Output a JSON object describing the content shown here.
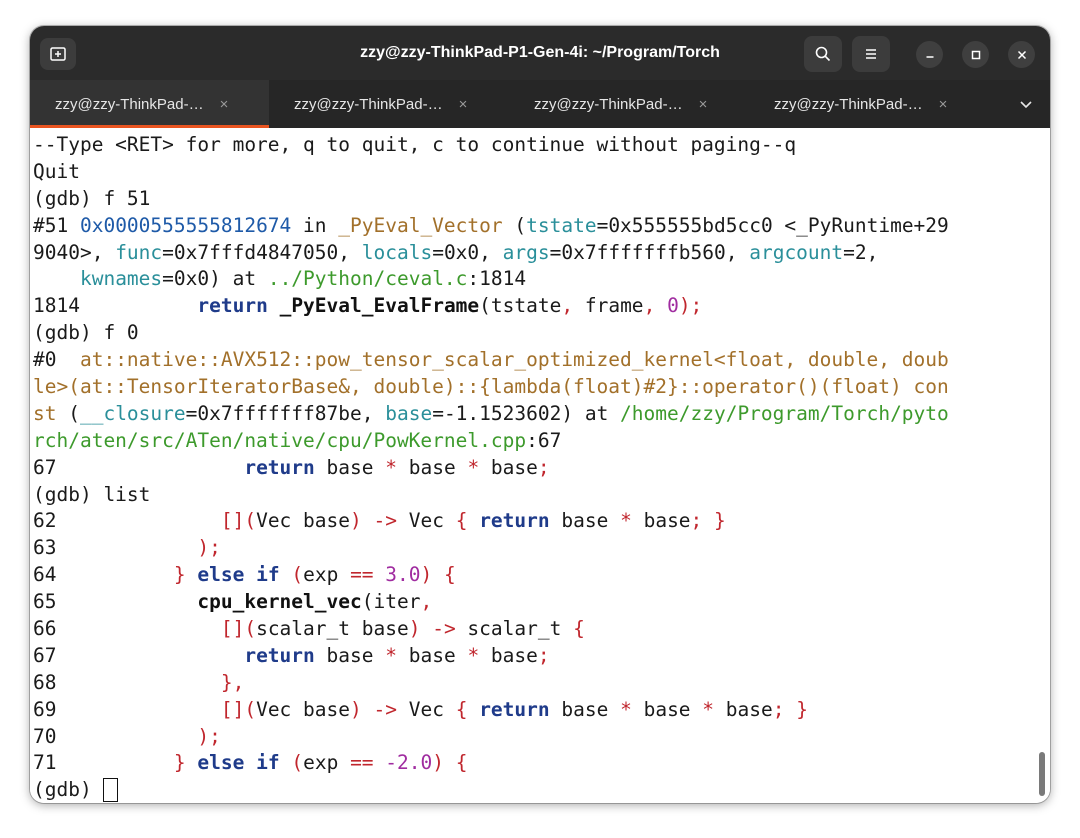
{
  "window": {
    "title": "zzy@zzy-ThinkPad-P1-Gen-4i: ~/Program/Torch"
  },
  "header_icons": {
    "new_tab": "new-tab-icon",
    "search": "search-icon",
    "menu": "hamburger-menu-icon",
    "minimize": "minimize-icon",
    "maximize": "maximize-icon",
    "close": "close-icon"
  },
  "tabs": [
    {
      "label": "zzy@zzy-ThinkPad-…",
      "active": true
    },
    {
      "label": "zzy@zzy-ThinkPad-…",
      "active": false
    },
    {
      "label": "zzy@zzy-ThinkPad-…",
      "active": false
    },
    {
      "label": "zzy@zzy-ThinkPad-…",
      "active": false
    }
  ],
  "tab_close_glyph": "×",
  "colors": {
    "keyword": "#1f3b8a",
    "operator": "#c0262d",
    "number": "#a02ca0",
    "address": "#1e5aa8",
    "param": "#2a8f9a",
    "function_name": "#a2702a",
    "path": "#3d9a2c",
    "tab_active_accent": "#e95420"
  },
  "terminal": {
    "lines": [
      [
        {
          "t": "--Type <RET> for more, q to quit, c to continue without paging--q"
        }
      ],
      [
        {
          "t": "Quit"
        }
      ],
      [
        {
          "t": "(gdb) f 51"
        }
      ],
      [
        {
          "t": "#51 "
        },
        {
          "t": "0x0000555555812674",
          "c": "addr"
        },
        {
          "t": " in "
        },
        {
          "t": "_PyEval_Vector",
          "c": "brown"
        },
        {
          "t": " ("
        },
        {
          "t": "tstate",
          "c": "teal"
        },
        {
          "t": "=0x555555bd5cc0 <_PyRuntime+29"
        }
      ],
      [
        {
          "t": "9040>, "
        },
        {
          "t": "func",
          "c": "teal"
        },
        {
          "t": "=0x7fffd4847050, "
        },
        {
          "t": "locals",
          "c": "teal"
        },
        {
          "t": "=0x0, "
        },
        {
          "t": "args",
          "c": "teal"
        },
        {
          "t": "=0x7fffffffb560, "
        },
        {
          "t": "argcount",
          "c": "teal"
        },
        {
          "t": "=2,"
        }
      ],
      [
        {
          "t": "    "
        },
        {
          "t": "kwnames",
          "c": "teal"
        },
        {
          "t": "=0x0) at "
        },
        {
          "t": "../Python/ceval.c",
          "c": "green"
        },
        {
          "t": ":1814"
        }
      ],
      [
        {
          "t": "1814\t      "
        },
        {
          "t": "return",
          "c": "kw"
        },
        {
          "t": " "
        },
        {
          "t": "_PyEval_EvalFrame",
          "c": "fnb"
        },
        {
          "t": "(tstate"
        },
        {
          "t": ",",
          "c": "red"
        },
        {
          "t": " frame"
        },
        {
          "t": ",",
          "c": "red"
        },
        {
          "t": " "
        },
        {
          "t": "0",
          "c": "num"
        },
        {
          "t": ");",
          "c": "red"
        }
      ],
      [
        {
          "t": "(gdb) f 0"
        }
      ],
      [
        {
          "t": "#0  "
        },
        {
          "t": "at::native::AVX512::pow_tensor_scalar_optimized_kernel<float, double, doub",
          "c": "brown"
        }
      ],
      [
        {
          "t": "le>(at::TensorIteratorBase&, double)::{lambda(float)#2}::operator()(float) con",
          "c": "brown"
        }
      ],
      [
        {
          "t": "st",
          "c": "brown"
        },
        {
          "t": " ("
        },
        {
          "t": "__closure",
          "c": "teal"
        },
        {
          "t": "=0x7fffffff87be, "
        },
        {
          "t": "base",
          "c": "teal"
        },
        {
          "t": "=-1.1523602) at "
        },
        {
          "t": "/home/zzy/Program/Torch/pyto",
          "c": "green"
        }
      ],
      [
        {
          "t": "rch/aten/src/ATen/native/cpu/PowKernel.cpp",
          "c": "green"
        },
        {
          "t": ":67"
        }
      ],
      [
        {
          "t": "67\t          "
        },
        {
          "t": "return",
          "c": "kw"
        },
        {
          "t": " base "
        },
        {
          "t": "*",
          "c": "red"
        },
        {
          "t": " base "
        },
        {
          "t": "*",
          "c": "red"
        },
        {
          "t": " base"
        },
        {
          "t": ";",
          "c": "red"
        }
      ],
      [
        {
          "t": "(gdb) list"
        }
      ],
      [
        {
          "t": "62\t        "
        },
        {
          "t": "[](",
          "c": "red"
        },
        {
          "t": "Vec base"
        },
        {
          "t": ")",
          "c": "red"
        },
        {
          "t": " "
        },
        {
          "t": "->",
          "c": "red"
        },
        {
          "t": " Vec "
        },
        {
          "t": "{",
          "c": "red"
        },
        {
          "t": " "
        },
        {
          "t": "return",
          "c": "kw"
        },
        {
          "t": " base "
        },
        {
          "t": "*",
          "c": "red"
        },
        {
          "t": " base"
        },
        {
          "t": ";",
          "c": "red"
        },
        {
          "t": " "
        },
        {
          "t": "}",
          "c": "red"
        }
      ],
      [
        {
          "t": "63\t      "
        },
        {
          "t": ");",
          "c": "red"
        }
      ],
      [
        {
          "t": "64\t    "
        },
        {
          "t": "}",
          "c": "red"
        },
        {
          "t": " "
        },
        {
          "t": "else",
          "c": "kw"
        },
        {
          "t": " "
        },
        {
          "t": "if",
          "c": "kw"
        },
        {
          "t": " "
        },
        {
          "t": "(",
          "c": "red"
        },
        {
          "t": "exp "
        },
        {
          "t": "==",
          "c": "red"
        },
        {
          "t": " "
        },
        {
          "t": "3.0",
          "c": "num"
        },
        {
          "t": ")",
          "c": "red"
        },
        {
          "t": " "
        },
        {
          "t": "{",
          "c": "red"
        }
      ],
      [
        {
          "t": "65\t      "
        },
        {
          "t": "cpu_kernel_vec",
          "c": "fnb"
        },
        {
          "t": "(iter"
        },
        {
          "t": ",",
          "c": "red"
        }
      ],
      [
        {
          "t": "66\t        "
        },
        {
          "t": "[](",
          "c": "red"
        },
        {
          "t": "scalar_t base"
        },
        {
          "t": ")",
          "c": "red"
        },
        {
          "t": " "
        },
        {
          "t": "->",
          "c": "red"
        },
        {
          "t": " scalar_t "
        },
        {
          "t": "{",
          "c": "red"
        }
      ],
      [
        {
          "t": "67\t          "
        },
        {
          "t": "return",
          "c": "kw"
        },
        {
          "t": " base "
        },
        {
          "t": "*",
          "c": "red"
        },
        {
          "t": " base "
        },
        {
          "t": "*",
          "c": "red"
        },
        {
          "t": " base"
        },
        {
          "t": ";",
          "c": "red"
        }
      ],
      [
        {
          "t": "68\t        "
        },
        {
          "t": "},",
          "c": "red"
        }
      ],
      [
        {
          "t": "69\t        "
        },
        {
          "t": "[](",
          "c": "red"
        },
        {
          "t": "Vec base"
        },
        {
          "t": ")",
          "c": "red"
        },
        {
          "t": " "
        },
        {
          "t": "->",
          "c": "red"
        },
        {
          "t": " Vec "
        },
        {
          "t": "{",
          "c": "red"
        },
        {
          "t": " "
        },
        {
          "t": "return",
          "c": "kw"
        },
        {
          "t": " base "
        },
        {
          "t": "*",
          "c": "red"
        },
        {
          "t": " base "
        },
        {
          "t": "*",
          "c": "red"
        },
        {
          "t": " base"
        },
        {
          "t": ";",
          "c": "red"
        },
        {
          "t": " "
        },
        {
          "t": "}",
          "c": "red"
        }
      ],
      [
        {
          "t": "70\t      "
        },
        {
          "t": ");",
          "c": "red"
        }
      ],
      [
        {
          "t": "71\t    "
        },
        {
          "t": "}",
          "c": "red"
        },
        {
          "t": " "
        },
        {
          "t": "else",
          "c": "kw"
        },
        {
          "t": " "
        },
        {
          "t": "if",
          "c": "kw"
        },
        {
          "t": " "
        },
        {
          "t": "(",
          "c": "red"
        },
        {
          "t": "exp "
        },
        {
          "t": "==",
          "c": "red"
        },
        {
          "t": " "
        },
        {
          "t": "-2.0",
          "c": "num"
        },
        {
          "t": ")",
          "c": "red"
        },
        {
          "t": " "
        },
        {
          "t": "{",
          "c": "red"
        }
      ]
    ],
    "prompt": "(gdb) "
  }
}
